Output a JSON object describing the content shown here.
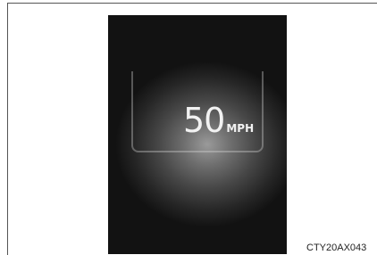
{
  "display": {
    "speed_value": "50",
    "speed_unit": "MPH"
  },
  "figure": {
    "code": "CTY20AX043"
  },
  "colors": {
    "panel_background": "#121212",
    "readout_text": "#f2f2f2",
    "page_background": "#ffffff"
  }
}
